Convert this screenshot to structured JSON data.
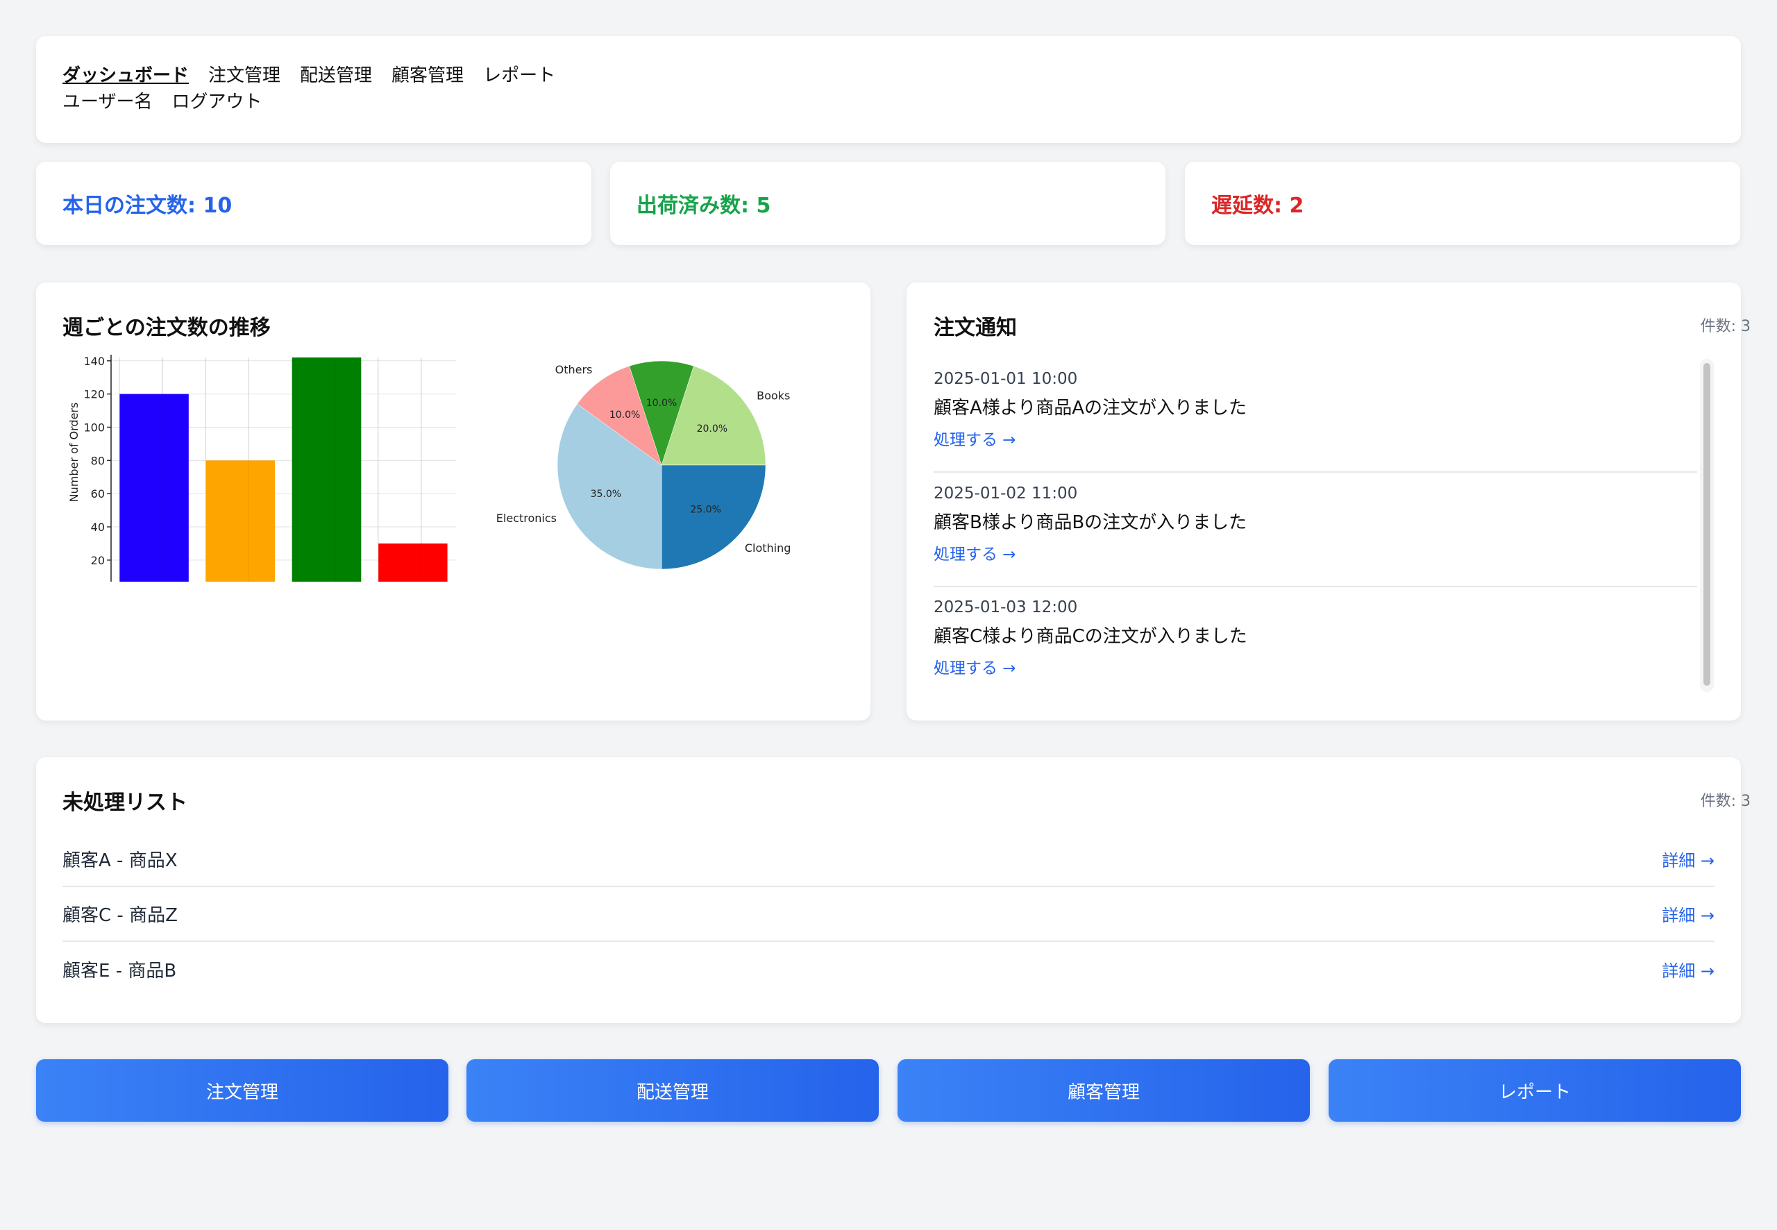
{
  "nav": {
    "items": [
      "ダッシュボード",
      "注文管理",
      "配送管理",
      "顧客管理",
      "レポート"
    ],
    "user": "ユーザー名",
    "logout": "ログアウト"
  },
  "stats": [
    {
      "label": "本日の注文数: 10",
      "color": "#2563eb"
    },
    {
      "label": "出荷済み数: 5",
      "color": "#16a34a"
    },
    {
      "label": "遅延数: 2",
      "color": "#dc2626"
    }
  ],
  "chart_panel": {
    "title": "週ごとの注文数の推移"
  },
  "chart_data": [
    {
      "type": "bar",
      "title": "",
      "xlabel": "",
      "ylabel": "Number of Orders",
      "values": [
        120,
        80,
        142,
        30
      ],
      "colors": [
        "#1f00ff",
        "#ffa500",
        "#008000",
        "#ff0000"
      ],
      "ylim": [
        7,
        142
      ],
      "yticks": [
        20,
        40,
        60,
        80,
        100,
        120,
        140
      ],
      "grid": true
    },
    {
      "type": "pie",
      "categories": [
        "Books",
        "Clothing",
        "Electronics",
        "Others",
        ""
      ],
      "values": [
        20.0,
        25.0,
        35.0,
        10.0,
        10.0
      ],
      "labels": [
        "20.0%",
        "25.0%",
        "35.0%",
        "10.0%",
        "10.0%"
      ],
      "colors": [
        "#b2df8a",
        "#1f78b4",
        "#a6cee3",
        "#fb9a99",
        "#33a02c"
      ]
    }
  ],
  "notifications": {
    "title": "注文通知",
    "count": "件数: 3",
    "items": [
      {
        "time": "2025-01-01 10:00",
        "text": "顧客A様より商品Aの注文が入りました",
        "action": "処理する →"
      },
      {
        "time": "2025-01-02 11:00",
        "text": "顧客B様より商品Bの注文が入りました",
        "action": "処理する →"
      },
      {
        "time": "2025-01-03 12:00",
        "text": "顧客C様より商品Cの注文が入りました",
        "action": "処理する →"
      }
    ]
  },
  "pending": {
    "title": "未処理リスト",
    "count": "件数: 3",
    "items": [
      {
        "text": "顧客A - 商品X",
        "action": "詳細 →"
      },
      {
        "text": "顧客C - 商品Z",
        "action": "詳細 →"
      },
      {
        "text": "顧客E - 商品B",
        "action": "詳細 →"
      }
    ]
  },
  "buttons": [
    "注文管理",
    "配送管理",
    "顧客管理",
    "レポート"
  ]
}
